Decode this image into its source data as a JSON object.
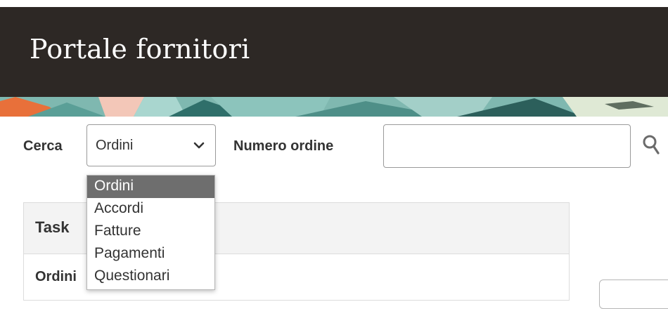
{
  "header": {
    "title": "Portale fornitori"
  },
  "search": {
    "label": "Cerca",
    "selected": "Ordini",
    "field_label": "Numero ordine",
    "input_value": "",
    "options": [
      "Ordini",
      "Accordi",
      "Fatture",
      "Pagamenti",
      "Questionari"
    ]
  },
  "tasks": {
    "heading": "Task",
    "row_label": "Ordini"
  },
  "colors": {
    "header_bg": "#2d2825",
    "dropdown_selected_bg": "#6e6e6e",
    "accent_orange": "#e8703a",
    "accent_teal": "#5fa8a2"
  },
  "icons": {
    "search": "search-icon",
    "chevron": "chevron-down-icon"
  }
}
